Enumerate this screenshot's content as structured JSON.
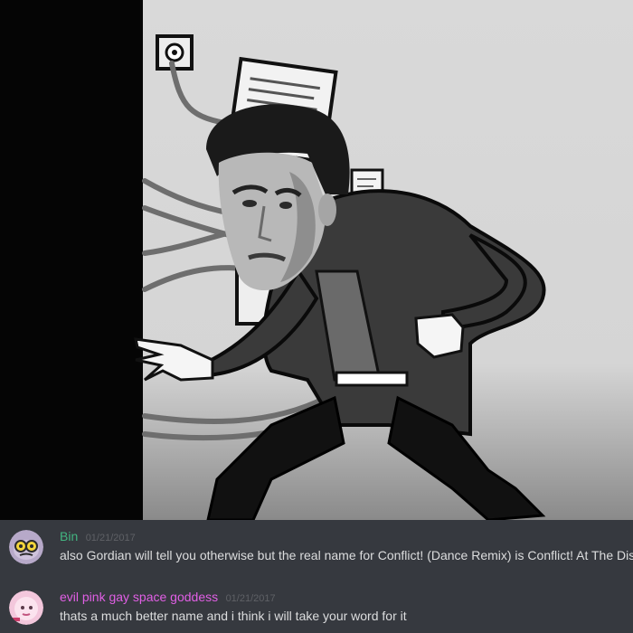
{
  "messages": [
    {
      "username": "Bin",
      "username_color": "#43b581",
      "timestamp": "01/21/2017",
      "text": "also Gordian will tell you otherwise but the real name for Conflict! (Dance Remix) is Conflict! At The Disco",
      "avatar_icon": "yellow-eyed-blob-avatar-icon"
    },
    {
      "username": "evil pink gay space goddess",
      "username_color": "#e15fe5",
      "timestamp": "01/21/2017",
      "text": "thats a much better name and i think i will take your word for it",
      "avatar_icon": "pink-character-avatar-icon"
    }
  ],
  "colors": {
    "chat_background": "#36393f",
    "message_text": "#dcddde",
    "timestamp": "#5f6166"
  }
}
